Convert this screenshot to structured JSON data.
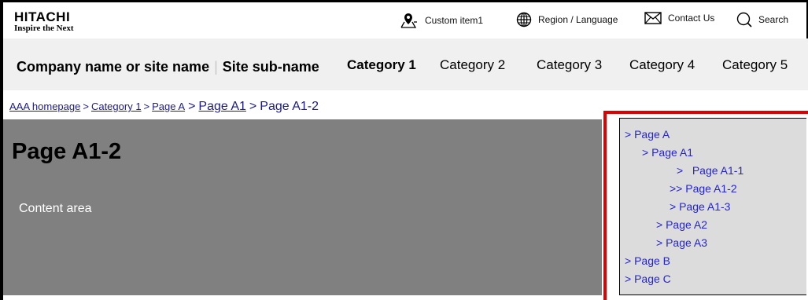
{
  "header": {
    "logo_brand": "HITACHI",
    "logo_tagline": "Inspire the Next",
    "utility": {
      "custom_item": "Custom item1",
      "region": "Region / Language",
      "contact": "Contact Us",
      "search": "Search"
    }
  },
  "nav": {
    "site_name": "Company name or site name",
    "separator": "|",
    "site_subname": "Site sub-name",
    "categories": [
      "Category 1",
      "Category 2",
      "Category 3",
      "Category 4",
      "Category 5"
    ]
  },
  "breadcrumb": {
    "items": [
      "AAA homepage",
      "Category 1",
      "Page A",
      "Page A1",
      "Page A1-2"
    ],
    "separator": ">"
  },
  "content": {
    "title": "Page A1-2",
    "text": "Content area"
  },
  "sidenav": {
    "items": [
      "> Page A",
      "> Page A1",
      ">   Page A1-1",
      ">> Page A1-2",
      "> Page A1-3",
      "> Page A2",
      "> Page A3",
      "> Page B",
      "> Page C"
    ]
  },
  "colors": {
    "link": "#1b1b8a",
    "sidenav_link": "#2323d8",
    "highlight_border": "#e00000",
    "content_bg": "#808080",
    "nav_bg": "#f0f0f0",
    "sidenav_bg": "#dcdcdc"
  }
}
